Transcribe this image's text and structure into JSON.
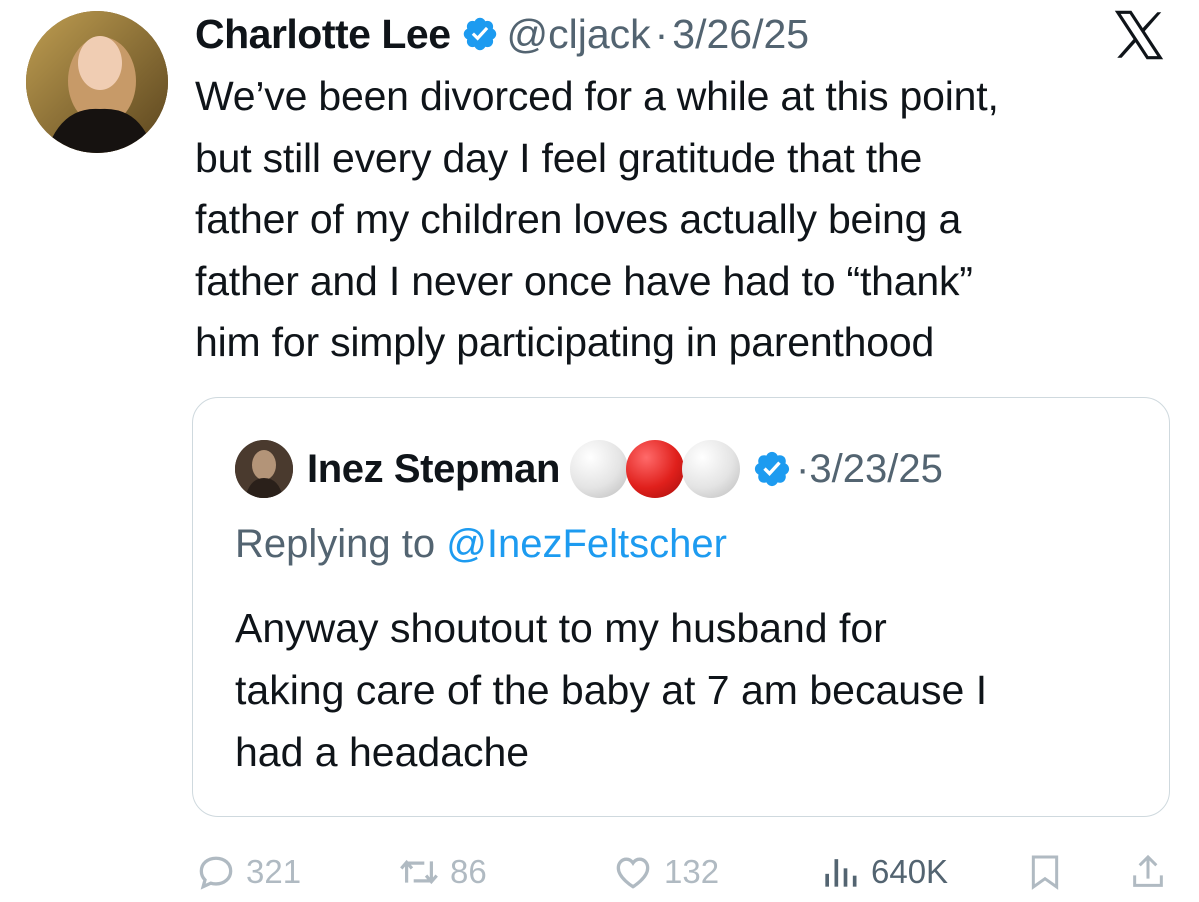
{
  "author": {
    "name": "Charlotte Lee",
    "handle": "@cljack",
    "separator": "·",
    "date": "3/26/25"
  },
  "tweet": {
    "lines": [
      "We’ve been divorced for a while at this point,",
      "but still every day I feel gratitude that the",
      "father of my children loves actually being a",
      "father and I never once have had to “thank”",
      "him for simply participating in parenthood"
    ]
  },
  "quote": {
    "name": "Inez Stepman",
    "separator": "·",
    "date": "3/23/25",
    "replying_prefix": "Replying to ",
    "replying_handle": "@InezFeltscher",
    "lines": [
      "Anyway shoutout to my husband for",
      "taking care of the baby at 7 am because I",
      "had a headache"
    ]
  },
  "actions": {
    "replies": "321",
    "reposts": "86",
    "likes": "132",
    "views": "640K"
  },
  "colors": {
    "accent": "#1d9bf0",
    "muted": "#536471",
    "border": "#cfd9de"
  },
  "icons": [
    "x-logo-icon",
    "verified-badge-icon",
    "reply-icon",
    "repost-icon",
    "like-icon",
    "views-icon",
    "bookmark-icon",
    "share-icon"
  ]
}
